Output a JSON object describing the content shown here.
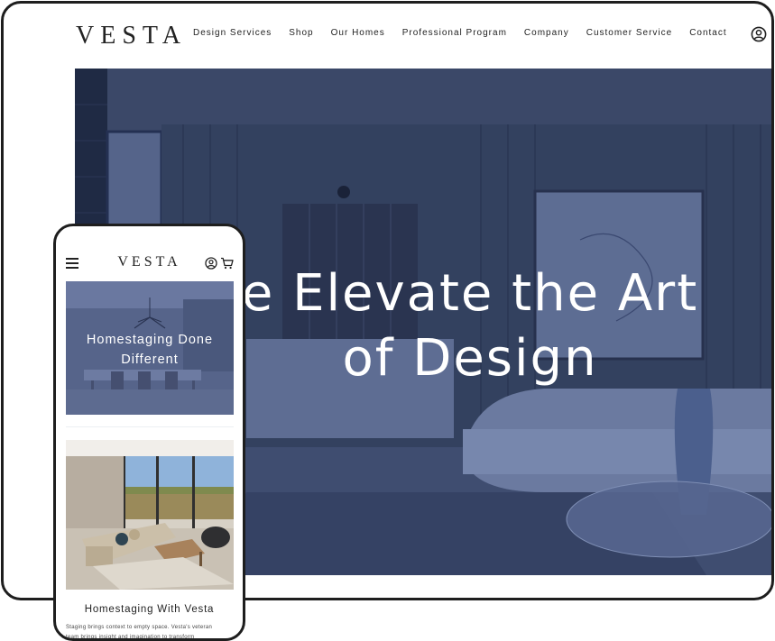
{
  "desktop": {
    "logo": "VESTA",
    "nav": [
      "Design Services",
      "Shop",
      "Our Homes",
      "Professional Program",
      "Company",
      "Customer Service",
      "Contact"
    ],
    "hero_title_line1": "e Elevate the Art",
    "hero_title_line2": "of Design"
  },
  "mobile": {
    "logo": "VESTA",
    "card1_title_line1": "Homestaging Done",
    "card1_title_line2": "Different",
    "card2_title": "Homestaging With Vesta",
    "card2_text_line1": "Staging brings context to empty space. Vesta's veteran",
    "card2_text_line2": "team brings insight and imagination to transform"
  },
  "colors": {
    "hero_overlay": "#2f3d5c",
    "frame": "#1e1e1e",
    "text_dark": "#222222"
  },
  "icons": {
    "user": "user-circle-icon",
    "menu": "hamburger-menu-icon",
    "cart": "shopping-cart-icon"
  }
}
